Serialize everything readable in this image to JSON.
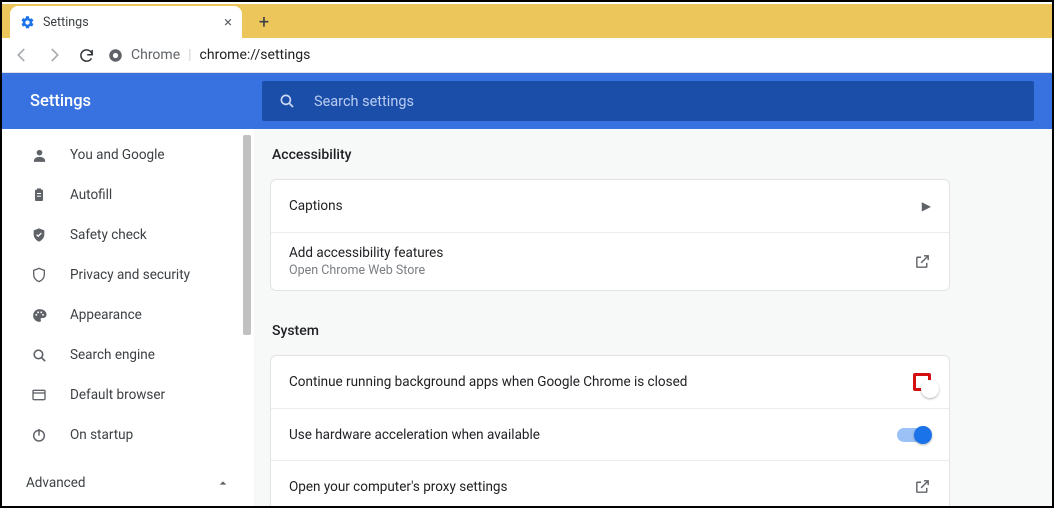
{
  "browser": {
    "tab_title": "Settings",
    "omnibox_prefix": "Chrome",
    "omnibox_url": "chrome://settings"
  },
  "header": {
    "title": "Settings",
    "search_placeholder": "Search settings"
  },
  "sidebar": {
    "items": [
      {
        "label": "You and Google"
      },
      {
        "label": "Autofill"
      },
      {
        "label": "Safety check"
      },
      {
        "label": "Privacy and security"
      },
      {
        "label": "Appearance"
      },
      {
        "label": "Search engine"
      },
      {
        "label": "Default browser"
      },
      {
        "label": "On startup"
      }
    ],
    "advanced_label": "Advanced"
  },
  "main": {
    "accessibility": {
      "title": "Accessibility",
      "captions": "Captions",
      "add_features": "Add accessibility features",
      "add_features_sub": "Open Chrome Web Store"
    },
    "system": {
      "title": "System",
      "bg_apps": "Continue running background apps when Google Chrome is closed",
      "hw_accel": "Use hardware acceleration when available",
      "proxy": "Open your computer's proxy settings"
    }
  }
}
